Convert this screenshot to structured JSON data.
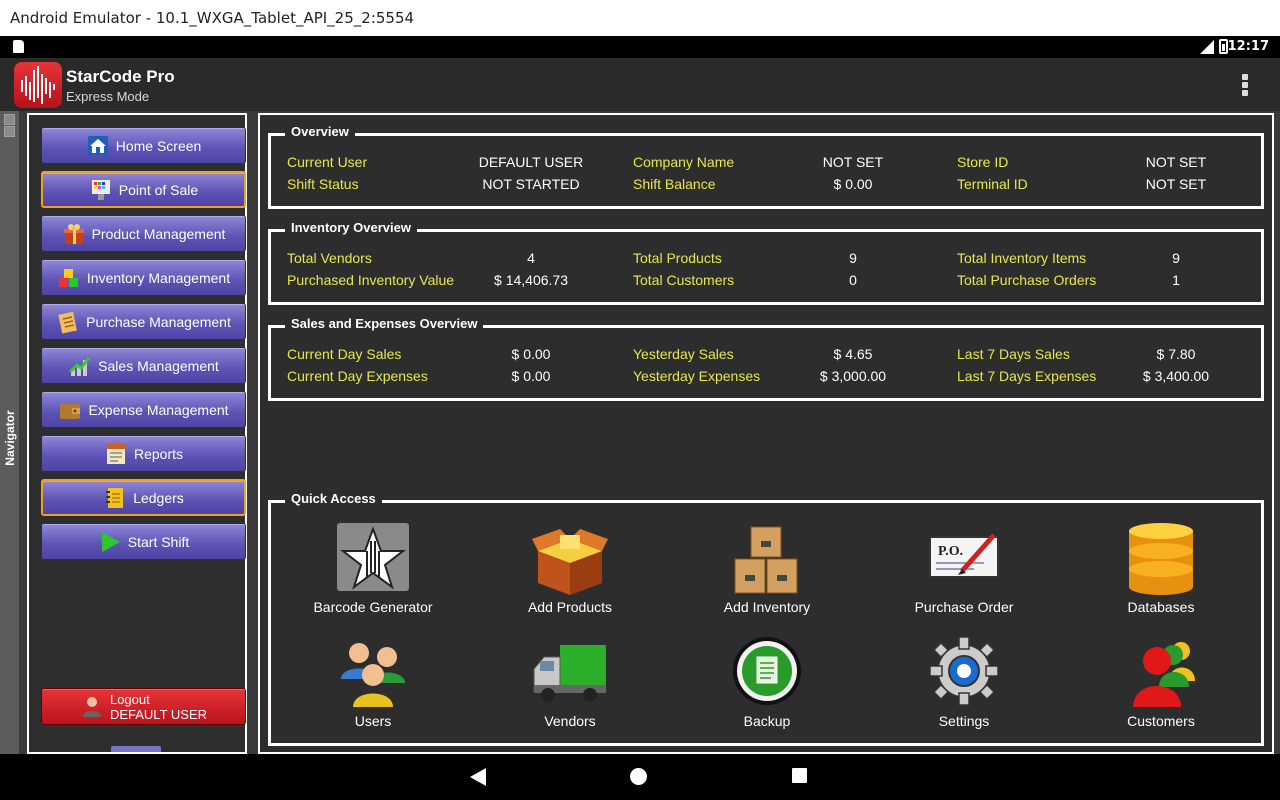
{
  "window": {
    "title": "Android Emulator - 10.1_WXGA_Tablet_API_25_2:5554"
  },
  "status_bar": {
    "time": "12:17"
  },
  "app_bar": {
    "title": "StarCode Pro",
    "subtitle": "Express Mode"
  },
  "navigator": {
    "label": "Navigator",
    "items": [
      {
        "label": "Home Screen",
        "icon": "house-icon"
      },
      {
        "label": "Point of Sale",
        "icon": "cash-register-icon"
      },
      {
        "label": "Product Management",
        "icon": "gift-box-icon"
      },
      {
        "label": "Inventory Management",
        "icon": "cubes-icon"
      },
      {
        "label": "Purchase Management",
        "icon": "clipboard-icon"
      },
      {
        "label": "Sales Management",
        "icon": "growth-chart-icon"
      },
      {
        "label": "Expense Management",
        "icon": "wallet-icon"
      },
      {
        "label": "Reports",
        "icon": "report-icon"
      },
      {
        "label": "Ledgers",
        "icon": "notebook-icon"
      },
      {
        "label": "Start Shift",
        "icon": "play-icon"
      }
    ],
    "logout": {
      "line1": "Logout",
      "line2": "DEFAULT USER"
    }
  },
  "overview": {
    "title": "Overview",
    "rows": [
      [
        {
          "label": "Current User",
          "value": "DEFAULT USER"
        },
        {
          "label": "Company Name",
          "value": "NOT SET"
        },
        {
          "label": "Store ID",
          "value": "NOT SET"
        }
      ],
      [
        {
          "label": "Shift Status",
          "value": "NOT STARTED"
        },
        {
          "label": "Shift Balance",
          "value": "$ 0.00"
        },
        {
          "label": "Terminal ID",
          "value": "NOT SET"
        }
      ]
    ]
  },
  "inventory_overview": {
    "title": "Inventory Overview",
    "rows": [
      [
        {
          "label": "Total Vendors",
          "value": "4"
        },
        {
          "label": "Total Products",
          "value": "9"
        },
        {
          "label": "Total Inventory Items",
          "value": "9"
        }
      ],
      [
        {
          "label": "Purchased Inventory Value",
          "value": "$ 14,406.73"
        },
        {
          "label": "Total Customers",
          "value": "0"
        },
        {
          "label": "Total Purchase Orders",
          "value": "1"
        }
      ]
    ]
  },
  "sales_overview": {
    "title": "Sales and Expenses Overview",
    "rows": [
      [
        {
          "label": "Current Day Sales",
          "value": "$ 0.00"
        },
        {
          "label": "Yesterday Sales",
          "value": "$ 4.65"
        },
        {
          "label": "Last 7 Days Sales",
          "value": "$ 7.80"
        }
      ],
      [
        {
          "label": "Current Day Expenses",
          "value": "$ 0.00"
        },
        {
          "label": "Yesterday Expenses",
          "value": "$ 3,000.00"
        },
        {
          "label": "Last 7 Days Expenses",
          "value": "$ 3,400.00"
        }
      ]
    ]
  },
  "quick_access": {
    "title": "Quick Access",
    "items": [
      {
        "label": "Barcode Generator",
        "icon": "barcode-star-icon"
      },
      {
        "label": "Add Products",
        "icon": "open-box-icon"
      },
      {
        "label": "Add Inventory",
        "icon": "stacked-boxes-icon"
      },
      {
        "label": "Purchase Order",
        "icon": "purchase-order-icon"
      },
      {
        "label": "Databases",
        "icon": "database-icon"
      },
      {
        "label": "Users",
        "icon": "users-icon"
      },
      {
        "label": "Vendors",
        "icon": "truck-icon"
      },
      {
        "label": "Backup",
        "icon": "backup-icon"
      },
      {
        "label": "Settings",
        "icon": "gear-icon"
      },
      {
        "label": "Customers",
        "icon": "customers-icon"
      }
    ]
  }
}
